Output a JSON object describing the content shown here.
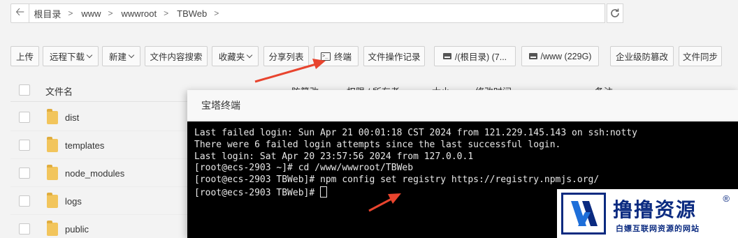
{
  "address_bar": {
    "crumbs": [
      "根目录",
      "www",
      "wwwroot",
      "TBWeb"
    ]
  },
  "toolbar": {
    "upload": "上传",
    "remote_download": "远程下载",
    "new": "新建",
    "content_search": "文件内容搜索",
    "favorites": "收藏夹",
    "share_list": "分享列表",
    "terminal": "终端",
    "operation_log": "文件操作记录",
    "disk_root": "/(根目录) (7...",
    "disk_www": "/www (229G)",
    "tamper_proof": "企业级防篡改",
    "file_sync": "文件同步"
  },
  "table": {
    "columns": [
      "文件名",
      "防篡改",
      "权限 / 所有者",
      "大小",
      "修改时间",
      "备注"
    ],
    "rows": [
      "dist",
      "templates",
      "node_modules",
      "logs",
      "public"
    ]
  },
  "dialog": {
    "title": "宝塔终端",
    "lines": [
      "Last failed login: Sun Apr 21 00:01:18 CST 2024 from 121.229.145.143 on ssh:notty",
      "There were 6 failed login attempts since the last successful login.",
      "Last login: Sat Apr 20 23:57:56 2024 from 127.0.0.1",
      "[root@ecs-2903 ~]# cd /www/wwwroot/TBWeb",
      "[root@ecs-2903 TBWeb]# npm config set registry https://registry.npmjs.org/",
      "[root@ecs-2903 TBWeb]# "
    ]
  },
  "watermark": {
    "name": "撸撸资源",
    "tagline": "白嫖互联网资源的网站",
    "reg": "®"
  },
  "colors": {
    "arrow": "#e8442e",
    "folder": "#f2c55c",
    "logo_blue": "#0a2a80"
  }
}
